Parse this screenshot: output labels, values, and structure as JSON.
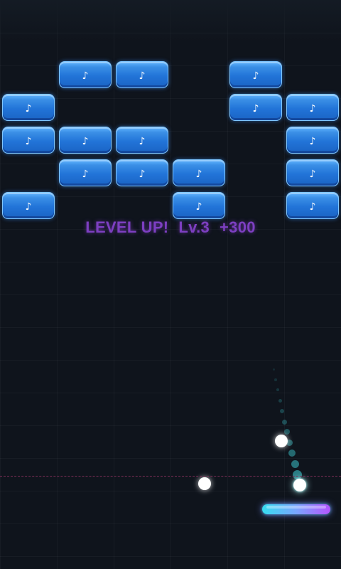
{
  "game": {
    "theme": "neon brick breaker",
    "background_color": "#0f141c",
    "brick_color": "#2274d8",
    "paddle_gradient": [
      "#37dcf0",
      "#b455ff"
    ],
    "deadline_color": "#7b2d57"
  },
  "banner": {
    "level_up": "LEVEL UP!",
    "level": "Lv.3",
    "bonus": "+300",
    "color": "#7d3fc1"
  },
  "bricks": [
    {
      "row": 0,
      "col": 1,
      "icon": "♪"
    },
    {
      "row": 0,
      "col": 2,
      "icon": "♪"
    },
    {
      "row": 0,
      "col": 4,
      "icon": "♪"
    },
    {
      "row": 1,
      "col": 0,
      "icon": "♪"
    },
    {
      "row": 1,
      "col": 4,
      "icon": "♪"
    },
    {
      "row": 1,
      "col": 5,
      "icon": "♪"
    },
    {
      "row": 2,
      "col": 0,
      "icon": "♪"
    },
    {
      "row": 2,
      "col": 1,
      "icon": "♪"
    },
    {
      "row": 2,
      "col": 2,
      "icon": "♪"
    },
    {
      "row": 2,
      "col": 5,
      "icon": "♪"
    },
    {
      "row": 3,
      "col": 1,
      "icon": "♪"
    },
    {
      "row": 3,
      "col": 2,
      "icon": "♪"
    },
    {
      "row": 3,
      "col": 3,
      "icon": "♪"
    },
    {
      "row": 3,
      "col": 5,
      "icon": "♪"
    },
    {
      "row": 4,
      "col": 0,
      "icon": "♪"
    },
    {
      "row": 4,
      "col": 3,
      "icon": "♪"
    },
    {
      "row": 4,
      "col": 5,
      "icon": "♪"
    }
  ],
  "balls": [
    {
      "name": "ball-main"
    },
    {
      "name": "ball-secondary"
    },
    {
      "name": "ball-tertiary"
    }
  ]
}
